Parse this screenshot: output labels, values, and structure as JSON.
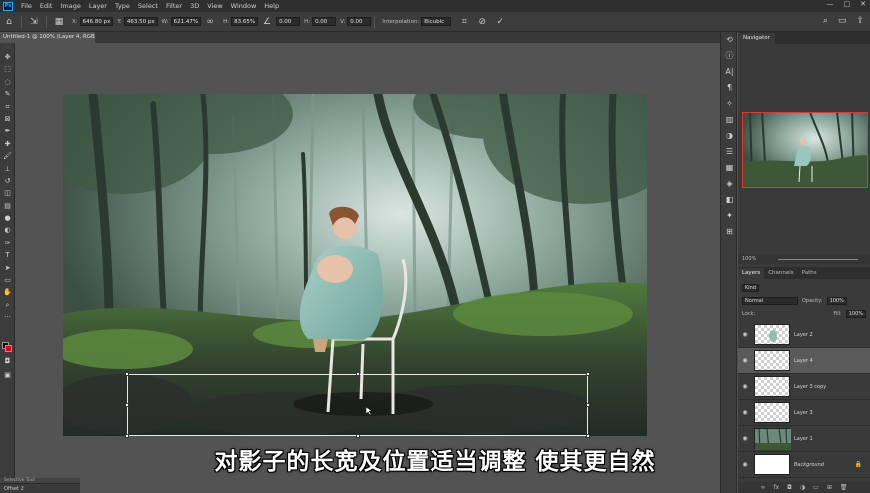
{
  "menubar": {
    "logo": "Ps",
    "items": [
      "File",
      "Edit",
      "Image",
      "Layer",
      "Type",
      "Select",
      "Filter",
      "3D",
      "View",
      "Window",
      "Help"
    ],
    "controls": [
      "—",
      "□",
      "✕"
    ]
  },
  "options": {
    "x_label": "X:",
    "x_value": "646.80 px",
    "y_label": "Y:",
    "y_value": "463.50 px",
    "w_label": "W:",
    "w_value": "621.47%",
    "h_label": "H:",
    "h_value": "83.65%",
    "angle_value": "0.00",
    "hskew_label": "H:",
    "hskew_value": "0.00",
    "vskew_label": "V:",
    "vskew_value": "0.00",
    "interp_label": "Interpolation:",
    "interp_value": "Bicubic"
  },
  "document": {
    "tab_title": "Untitled-1 @ 100% (Layer 4, RGB/8#) *"
  },
  "subtitle": "对影子的长宽及位置适当调整 使其更自然",
  "status": {
    "snapshot_label": "Selective Tool",
    "status_text": "Offset 2"
  },
  "navigator": {
    "tab": "Navigator",
    "zoom": "100%"
  },
  "layers_panel": {
    "tabs": [
      "Layers",
      "Channels",
      "Paths"
    ],
    "kind": "Kind",
    "blend_mode": "Normal",
    "opacity_label": "Opacity:",
    "opacity_value": "100%",
    "lock_label": "Lock:",
    "fill_label": "Fill:",
    "fill_value": "100%",
    "layers": [
      {
        "name": "Layer 2",
        "thumb": "checker-figure",
        "selected": false
      },
      {
        "name": "Layer 4",
        "thumb": "checker",
        "selected": true
      },
      {
        "name": "Layer 3 copy",
        "thumb": "checker",
        "selected": false
      },
      {
        "name": "Layer 3",
        "thumb": "checker",
        "selected": false
      },
      {
        "name": "Layer 1",
        "thumb": "forest",
        "selected": false
      },
      {
        "name": "Background",
        "thumb": "white",
        "selected": false
      }
    ],
    "footer_icons": [
      "link-icon",
      "fx-icon",
      "mask-icon",
      "adjustment-icon",
      "folder-icon",
      "new-layer-icon",
      "trash-icon"
    ]
  },
  "colors": {
    "foreground": "#111111",
    "background": "#e30613",
    "nav_frame": "#e8352c"
  }
}
